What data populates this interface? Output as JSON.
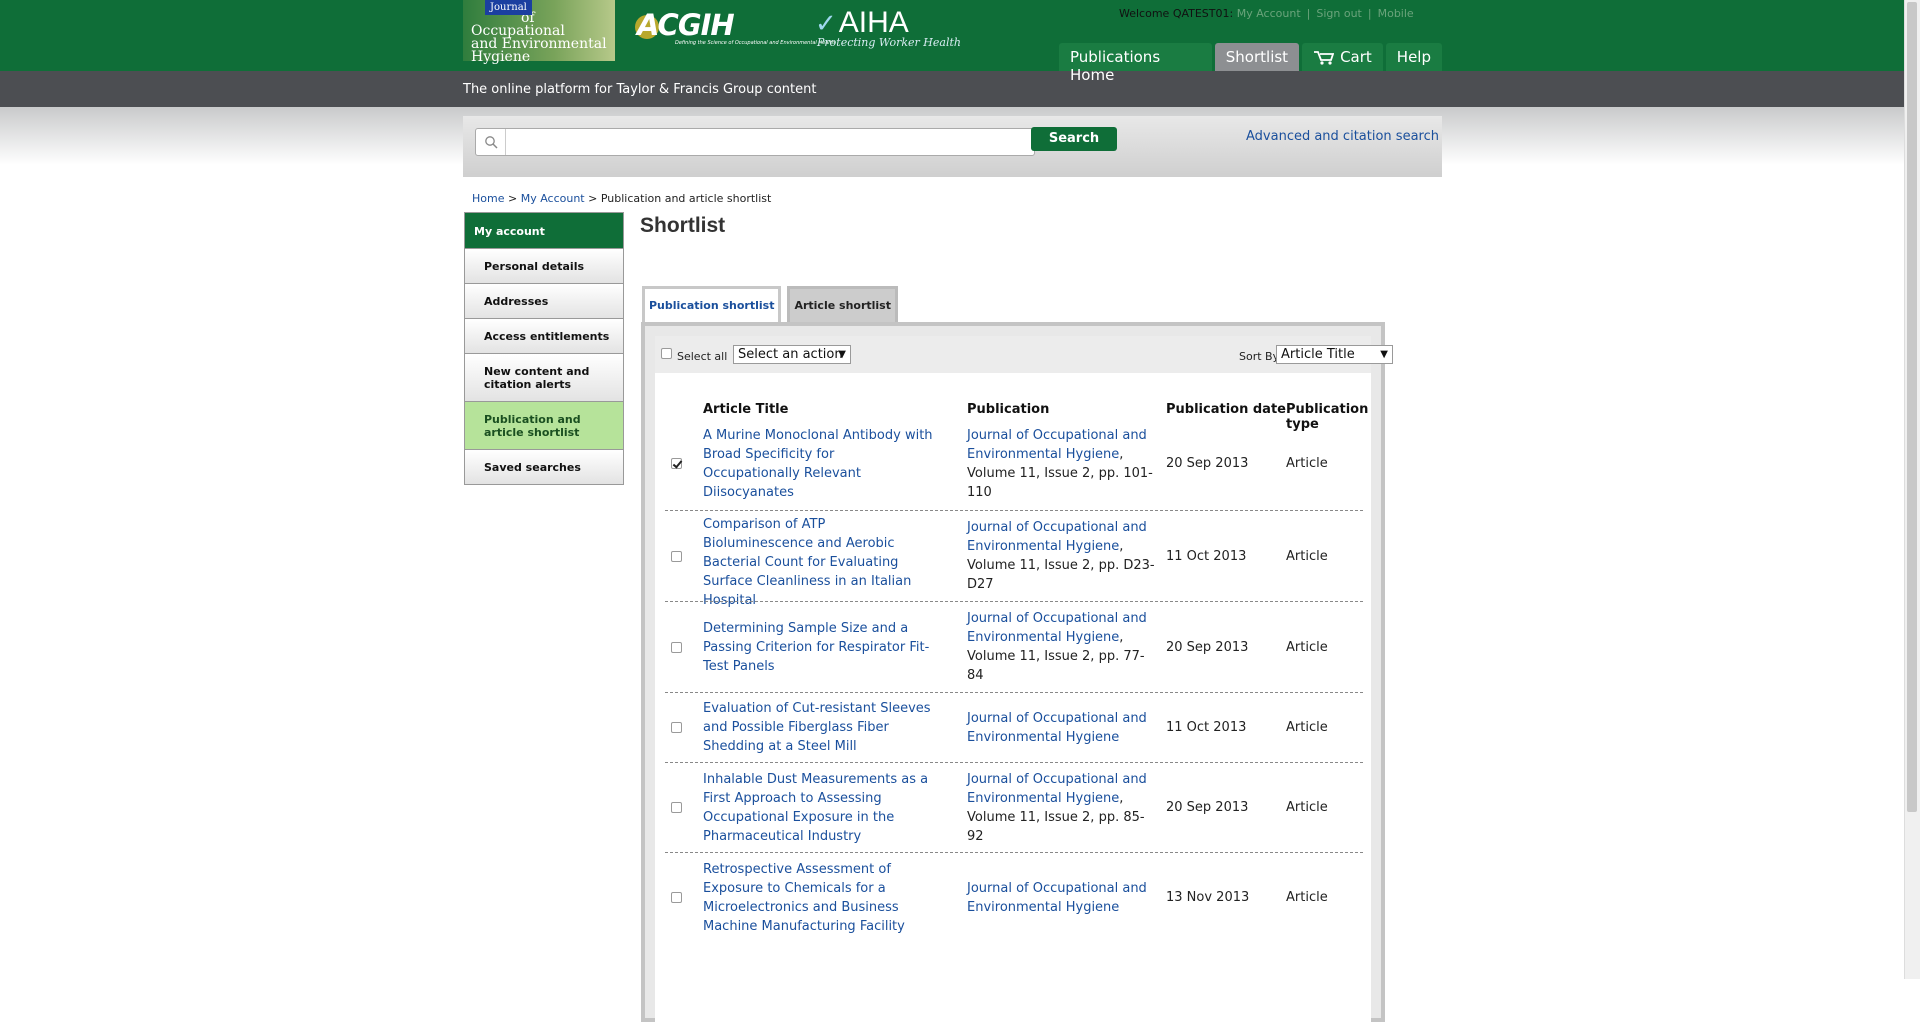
{
  "brand": {
    "journal_box": "Journal",
    "journal_lines": [
      "of",
      "Occupational",
      "and Environmental",
      "Hygiene"
    ],
    "acgih": "ACGIH",
    "acgih_tag": "Defining the Science of Occupational and Environmental Health",
    "aiha": "AIHA",
    "aiha_tag": "Protecting Worker Health"
  },
  "user": {
    "welcome": "Welcome QATEST01:",
    "my_account": "My Account",
    "sign_out": "Sign out",
    "mobile": "Mobile"
  },
  "nav": {
    "items": [
      "Publications Home",
      "Shortlist",
      "Cart",
      "Help"
    ],
    "active": "Shortlist"
  },
  "tagline": "The online platform for Taylor & Francis Group content",
  "search": {
    "button": "Search",
    "placeholder": "",
    "advanced": "Advanced and citation search"
  },
  "breadcrumb": {
    "home": "Home",
    "sep": ">",
    "account": "My Account",
    "current": "Publication and article shortlist"
  },
  "sidebar": {
    "title": "My account",
    "items": [
      {
        "label": "Personal details"
      },
      {
        "label": "Addresses"
      },
      {
        "label": "Access entitlements"
      },
      {
        "label": "New content and citation alerts"
      },
      {
        "label": "Publication and article shortlist",
        "active": true
      },
      {
        "label": "Saved searches"
      }
    ]
  },
  "page": {
    "title": "Shortlist"
  },
  "tabs": [
    "Publication shortlist",
    "Article shortlist"
  ],
  "toolbar": {
    "select_all": "Select all",
    "action": "Select an action",
    "sort_by": "Sort By",
    "sort_value": "Article Title"
  },
  "table": {
    "headers": [
      "Article Title",
      "Publication",
      "Publication date",
      "Publication type"
    ],
    "rows": [
      {
        "checked": true,
        "title": "A Murine Monoclonal Antibody with Broad Specificity for Occupationally Relevant Diisocyanates",
        "publication": "Journal of Occupational and Environmental Hygiene",
        "details": "Volume 11, Issue 2, pp. 101-110",
        "date": "20 Sep 2013",
        "type": "Article"
      },
      {
        "checked": false,
        "title": "Comparison of ATP Bioluminescence and Aerobic Bacterial Count for Evaluating Surface Cleanliness in an Italian Hospital",
        "publication": "Journal of Occupational and Environmental Hygiene",
        "details": "Volume 11, Issue 2, pp. D23-D27",
        "date": "11 Oct 2013",
        "type": "Article"
      },
      {
        "checked": false,
        "title": "Determining Sample Size and a Passing Criterion for Respirator Fit-Test Panels",
        "publication": "Journal of Occupational and Environmental Hygiene",
        "details": "Volume 11, Issue 2, pp. 77-84",
        "date": "20 Sep 2013",
        "type": "Article"
      },
      {
        "checked": false,
        "title": "Evaluation of Cut-resistant Sleeves and Possible Fiberglass Fiber Shedding at a Steel Mill",
        "publication": "Journal of Occupational and Environmental Hygiene",
        "details": "",
        "date": "11 Oct 2013",
        "type": "Article"
      },
      {
        "checked": false,
        "title": "Inhalable Dust Measurements as a First Approach to Assessing Occupational Exposure in the Pharmaceutical Industry",
        "publication": "Journal of Occupational and Environmental Hygiene",
        "details": "Volume 11, Issue 2, pp. 85-92",
        "date": "20 Sep 2013",
        "type": "Article"
      },
      {
        "checked": false,
        "title": "Retrospective Assessment of Exposure to Chemicals for a Microelectronics and Business Machine Manufacturing Facility",
        "publication": "Journal of Occupational and Environmental Hygiene",
        "details": "",
        "date": "13 Nov 2013",
        "type": "Article"
      }
    ]
  }
}
